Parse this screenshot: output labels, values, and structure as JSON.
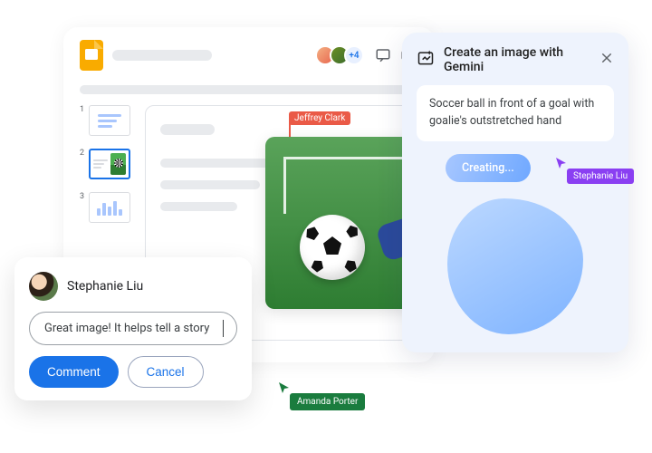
{
  "header": {
    "overflow_count": "+4"
  },
  "thumbs": {
    "numbers": [
      "1",
      "2",
      "3"
    ]
  },
  "canvas": {
    "collab_cursor_name": "Jeffrey Clark"
  },
  "gemini": {
    "title": "Create an image with Gemini",
    "prompt": "Soccer ball in front of a goal with goalie's outstretched hand",
    "creating_label": "Creating...",
    "cursor_name": "Stephanie Liu"
  },
  "comment": {
    "author": "Stephanie Liu",
    "input_value": "Great image! It helps tell a story",
    "submit_label": "Comment",
    "cancel_label": "Cancel"
  },
  "amanda": {
    "cursor_name": "Amanda Porter"
  },
  "colors": {
    "jeffrey_red": "#ea5a47",
    "stephanie_purple": "#8a3ff2",
    "amanda_green": "#1a7c3e",
    "primary_blue": "#1a73e8"
  }
}
